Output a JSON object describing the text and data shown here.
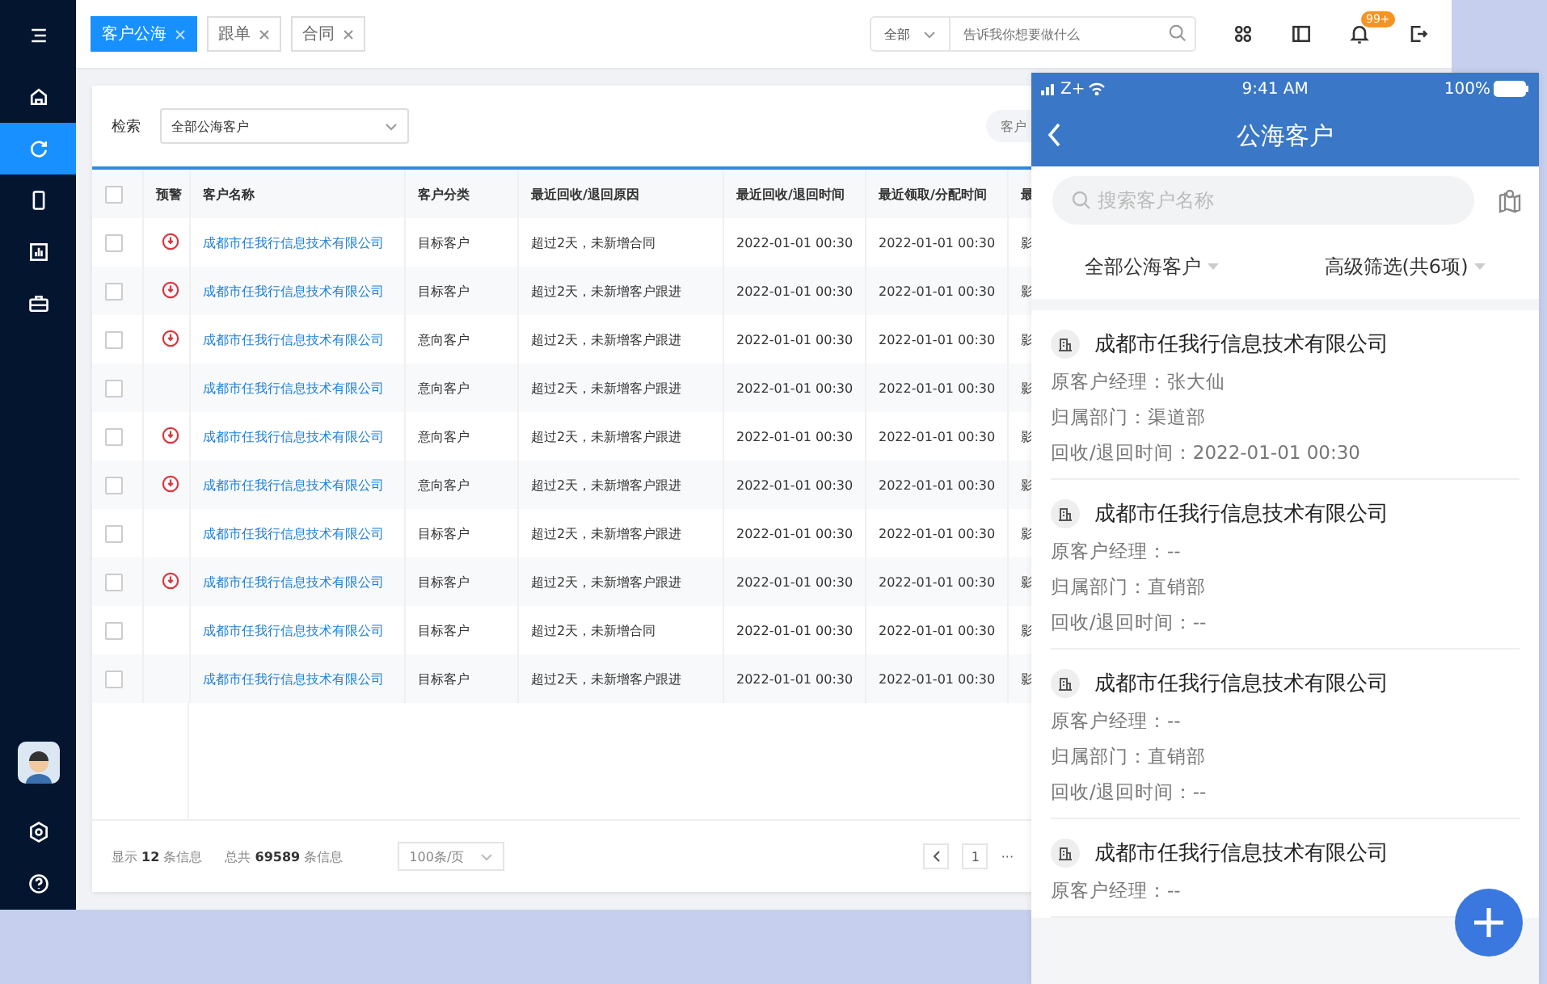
{
  "sidebar": {
    "items": [
      {
        "selected": false
      },
      {
        "selected": true
      },
      {
        "selected": false
      },
      {
        "selected": false
      },
      {
        "selected": false
      }
    ]
  },
  "tabs": [
    {
      "label": "客户公海",
      "selected": true
    },
    {
      "label": "跟单",
      "selected": false
    },
    {
      "label": "合同",
      "selected": false
    }
  ],
  "top_search": {
    "scope": "全部",
    "placeholder": "告诉我你想要做什么"
  },
  "notification_badge": "99+",
  "filter": {
    "label": "检索",
    "select": "全部公海客户",
    "search_placeholder": "客户"
  },
  "table": {
    "all_checked": false,
    "columns": [
      "预警",
      "客户名称",
      "客户分类",
      "最近回收/退回原因",
      "最近回收/退回时间",
      "最近领取/分配时间",
      "最"
    ],
    "rows": [
      {
        "checked": false,
        "warning": true,
        "name": "成都市任我行信息技术有限公司",
        "category": "目标客户",
        "reason": "超过2天，未新增合同",
        "recycled": "2022-01-01 00:30",
        "claimed": "2022-01-01 00:30",
        "column_8": "影"
      },
      {
        "checked": false,
        "warning": true,
        "name": "成都市任我行信息技术有限公司",
        "category": "目标客户",
        "reason": "超过2天，未新增客户跟进",
        "recycled": "2022-01-01 00:30",
        "claimed": "2022-01-01 00:30",
        "column_8": "影"
      },
      {
        "checked": false,
        "warning": true,
        "name": "成都市任我行信息技术有限公司",
        "category": "意向客户",
        "reason": "超过2天，未新增客户跟进",
        "recycled": "2022-01-01 00:30",
        "claimed": "2022-01-01 00:30",
        "column_8": "影"
      },
      {
        "checked": false,
        "warning": false,
        "name": "成都市任我行信息技术有限公司",
        "category": "意向客户",
        "reason": "超过2天，未新增客户跟进",
        "recycled": "2022-01-01 00:30",
        "claimed": "2022-01-01 00:30",
        "column_8": "影"
      },
      {
        "checked": false,
        "warning": true,
        "name": "成都市任我行信息技术有限公司",
        "category": "意向客户",
        "reason": "超过2天，未新增客户跟进",
        "recycled": "2022-01-01 00:30",
        "claimed": "2022-01-01 00:30",
        "column_8": "影"
      },
      {
        "checked": false,
        "warning": true,
        "name": "成都市任我行信息技术有限公司",
        "category": "意向客户",
        "reason": "超过2天，未新增客户跟进",
        "recycled": "2022-01-01 00:30",
        "claimed": "2022-01-01 00:30",
        "column_8": "影"
      },
      {
        "checked": false,
        "warning": false,
        "name": "成都市任我行信息技术有限公司",
        "category": "目标客户",
        "reason": "超过2天，未新增客户跟进",
        "recycled": "2022-01-01 00:30",
        "claimed": "2022-01-01 00:30",
        "column_8": "影"
      },
      {
        "checked": false,
        "warning": true,
        "name": "成都市任我行信息技术有限公司",
        "category": "目标客户",
        "reason": "超过2天，未新增客户跟进",
        "recycled": "2022-01-01 00:30",
        "claimed": "2022-01-01 00:30",
        "column_8": "影"
      },
      {
        "checked": false,
        "warning": false,
        "name": "成都市任我行信息技术有限公司",
        "category": "目标客户",
        "reason": "超过2天，未新增合同",
        "recycled": "2022-01-01 00:30",
        "claimed": "2022-01-01 00:30",
        "column_8": "影"
      },
      {
        "checked": false,
        "warning": false,
        "name": "成都市任我行信息技术有限公司",
        "category": "目标客户",
        "reason": "超过2天，未新增客户跟进",
        "recycled": "2022-01-01 00:30",
        "claimed": "2022-01-01 00:30",
        "column_8": "影"
      }
    ]
  },
  "footer": {
    "shown": "显示 **12** 条信息",
    "total": "总共 **69589** 条信息",
    "page_size": "100条/页",
    "page": "1",
    "more": "···"
  },
  "phone": {
    "carrier": "Z+",
    "time": "9:41 AM",
    "battery": "100%",
    "title": "公海客户",
    "search_placeholder": "搜索客户名称",
    "filters": [
      "全部公海客户",
      "高级筛选(共6项)"
    ],
    "cards": [
      {
        "name": "成都市任我行信息技术有限公司",
        "fields": [
          "原客户经理：张大仙",
          "归属部门：渠道部",
          "回收/退回时间：2022-01-01 00:30"
        ]
      },
      {
        "name": "成都市任我行信息技术有限公司",
        "fields": [
          "原客户经理：--",
          "归属部门：直销部",
          "回收/退回时间：--"
        ]
      },
      {
        "name": "成都市任我行信息技术有限公司",
        "fields": [
          "原客户经理：--",
          "归属部门：直销部",
          "回收/退回时间：--"
        ]
      },
      {
        "name": "成都市任我行信息技术有限公司",
        "fields": [
          "原客户经理：--"
        ]
      }
    ]
  }
}
